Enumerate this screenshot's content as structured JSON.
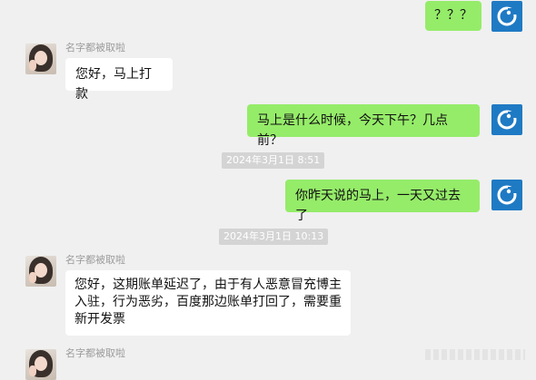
{
  "contact_name": "名字都被取啦",
  "messages": [
    {
      "text": "？？？"
    },
    {
      "text": "您好，马上打款"
    },
    {
      "text": "马上是什么时候，今天下午？几点前？"
    },
    {
      "text": "你昨天说的马上，一天又过去了"
    },
    {
      "text": "您好，这期账单延迟了，由于有人恶意冒充博主入驻，行为恶劣，百度那边账单打回了，需要重新开发票"
    }
  ],
  "timestamps": [
    "2024年3月1日 8:51",
    "2024年3月1日 10:13"
  ],
  "colors": {
    "background": "#f0f0f0",
    "bubble_me": "#95ec69",
    "bubble_other": "#ffffff",
    "avatar_me": "#1f7ac4"
  },
  "icons": {
    "my_avatar": "c-logo-icon",
    "contact_avatar": "photo-avatar"
  }
}
